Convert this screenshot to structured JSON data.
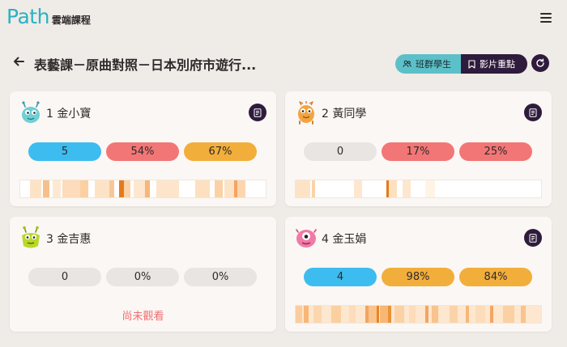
{
  "app": {
    "logo_word": "Path",
    "logo_sub": "雲端課程"
  },
  "page": {
    "title": "表藝課－原曲對照－日本別府市遊行..."
  },
  "toggle": {
    "students_label": "班群學生",
    "highlights_label": "影片重點"
  },
  "students": [
    {
      "name": "1 金小寶",
      "avatar_icon": "teal-monster-icon",
      "stats": [
        "5",
        "54%",
        "67%"
      ],
      "stat_colors": [
        "#3dbcf0",
        "#f37676",
        "#f2ae3b"
      ],
      "watched": true
    },
    {
      "name": "2 黃同學",
      "avatar_icon": "orange-monster-icon",
      "stats": [
        "0",
        "17%",
        "25%"
      ],
      "stat_colors": [
        "#e9e5e2",
        "#f37676",
        "#f37676"
      ],
      "watched": true
    },
    {
      "name": "3 金吉惠",
      "avatar_icon": "green-monster-icon",
      "stats": [
        "0",
        "0%",
        "0%"
      ],
      "stat_colors": [
        "#e9e5e2",
        "#e9e5e2",
        "#e9e5e2"
      ],
      "watched": false,
      "status_text": "尚未觀看"
    },
    {
      "name": "4 金玉娟",
      "avatar_icon": "pink-monster-icon",
      "stats": [
        "4",
        "98%",
        "84%"
      ],
      "stat_colors": [
        "#3dbcf0",
        "#f2ae3b",
        "#f2ae3b"
      ],
      "watched": true
    }
  ],
  "colors": {
    "accent_teal": "#29b2c4",
    "dark_purple": "#2f1b3c",
    "background": "#efebe7"
  }
}
